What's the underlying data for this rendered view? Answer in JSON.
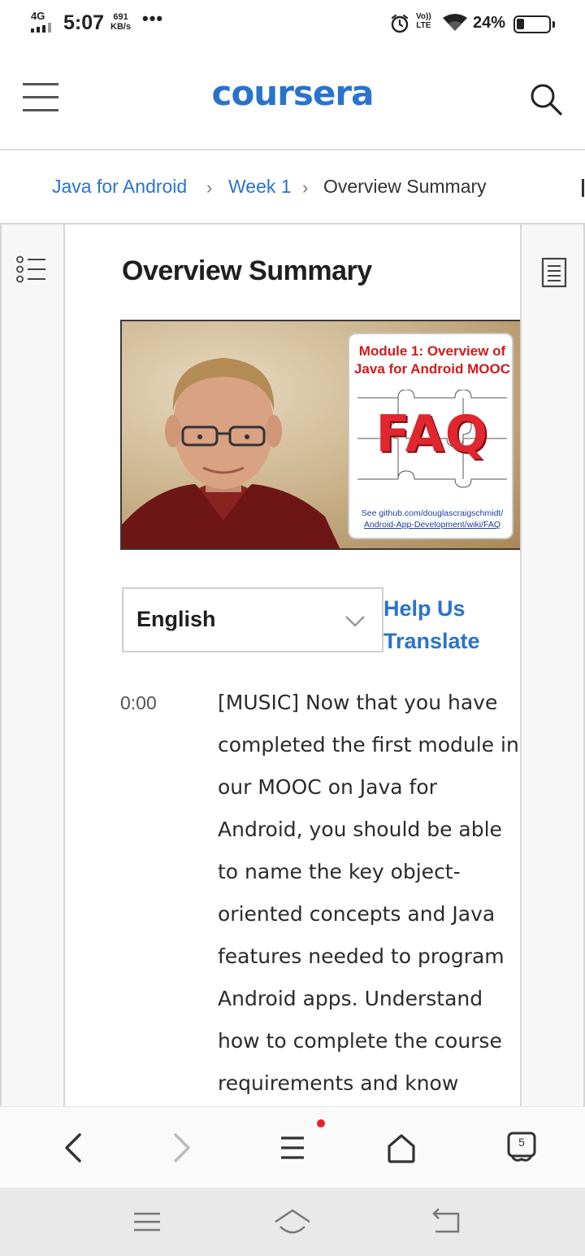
{
  "status_bar": {
    "network": "4G",
    "time": "5:07",
    "speed_value": "691",
    "speed_unit": "KB/s",
    "more": "•••",
    "volte_top": "Vo))",
    "volte_bottom": "LTE",
    "battery_percent": "24%",
    "battery_level": 0.24
  },
  "header": {
    "logo_text": "coursera"
  },
  "breadcrumb": {
    "items": [
      {
        "label": "Java for Android"
      },
      {
        "label": "Week 1"
      },
      {
        "label": "Overview Summary"
      }
    ]
  },
  "main": {
    "title": "Overview Summary",
    "video": {
      "slide_title_line1": "Module 1: Overview of",
      "slide_title_line2": "Java for Android MOOC",
      "slide_word": "FAQ",
      "slide_link_line1": "See github.com/douglascraigschmidt/",
      "slide_link_line2": "Android-App-Development/wiki/FAQ"
    },
    "language": {
      "selected": "English",
      "help_link": "Help Us Translate"
    },
    "transcript": {
      "timestamp": "0:00",
      "text": "[MUSIC] Now that you have completed the first module in our MOOC on Java for Android, you should be able to name the key object-oriented concepts and Java features needed to program Android apps. Understand how to complete the course requirements and know"
    }
  },
  "browser_bar": {
    "tabs_count": "5"
  },
  "colors": {
    "brand": "#2a73cc",
    "link": "#2a73cc",
    "notification_dot": "#e8202a"
  }
}
